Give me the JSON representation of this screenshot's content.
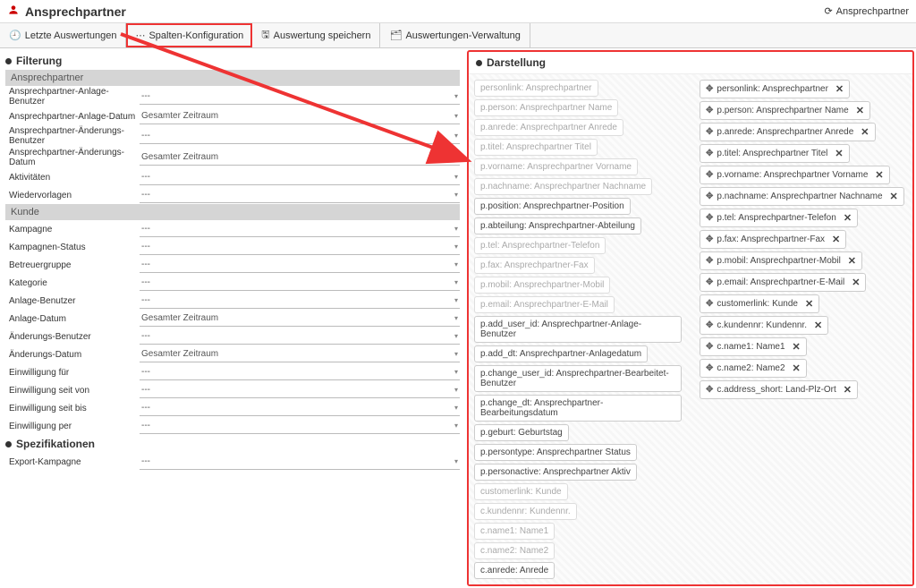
{
  "header": {
    "title": "Ansprechpartner",
    "refresh": "Ansprechpartner"
  },
  "toolbar": {
    "recent": "Letzte Auswertungen",
    "config": "Spalten-Konfiguration",
    "save": "Auswertung speichern",
    "manage": "Auswertungen-Verwaltung"
  },
  "filter": {
    "title": "Filterung",
    "groups": {
      "ansprechpartner": {
        "head": "Ansprechpartner",
        "rows": [
          {
            "label": "Ansprechpartner-Anlage-Benutzer",
            "value": "---"
          },
          {
            "label": "Ansprechpartner-Anlage-Datum",
            "value": "Gesamter Zeitraum"
          },
          {
            "label": "Ansprechpartner-Änderungs-Benutzer",
            "value": "---"
          },
          {
            "label": "Ansprechpartner-Änderungs-Datum",
            "value": "Gesamter Zeitraum"
          },
          {
            "label": "Aktivitäten",
            "value": "---"
          },
          {
            "label": "Wiedervorlagen",
            "value": "---"
          }
        ]
      },
      "kunde": {
        "head": "Kunde",
        "rows": [
          {
            "label": "Kampagne",
            "value": "---"
          },
          {
            "label": "Kampagnen-Status",
            "value": "---"
          },
          {
            "label": "Betreuergruppe",
            "value": "---"
          },
          {
            "label": "Kategorie",
            "value": "---"
          },
          {
            "label": "Anlage-Benutzer",
            "value": "---"
          },
          {
            "label": "Anlage-Datum",
            "value": "Gesamter Zeitraum"
          },
          {
            "label": "Änderungs-Benutzer",
            "value": "---"
          },
          {
            "label": "Änderungs-Datum",
            "value": "Gesamter Zeitraum"
          },
          {
            "label": "Einwilligung für",
            "value": "---"
          },
          {
            "label": "Einwilligung seit von",
            "value": "---"
          },
          {
            "label": "Einwilligung seit bis",
            "value": "---"
          },
          {
            "label": "Einwilligung per",
            "value": "---"
          }
        ]
      }
    },
    "spec": {
      "title": "Spezifikationen",
      "rows": [
        {
          "label": "Export-Kampagne",
          "value": "---"
        }
      ]
    }
  },
  "darstellung": {
    "title": "Darstellung",
    "available": [
      {
        "text": "personlink: Ansprechpartner",
        "disabled": true
      },
      {
        "text": "p.person: Ansprechpartner Name",
        "disabled": true
      },
      {
        "text": "p.anrede: Ansprechpartner Anrede",
        "disabled": true
      },
      {
        "text": "p.titel: Ansprechpartner Titel",
        "disabled": true
      },
      {
        "text": "p.vorname: Ansprechpartner Vorname",
        "disabled": true
      },
      {
        "text": "p.nachname: Ansprechpartner Nachname",
        "disabled": true
      },
      {
        "text": "p.position: Ansprechpartner-Position",
        "disabled": false
      },
      {
        "text": "p.abteilung: Ansprechpartner-Abteilung",
        "disabled": false
      },
      {
        "text": "p.tel: Ansprechpartner-Telefon",
        "disabled": true
      },
      {
        "text": "p.fax: Ansprechpartner-Fax",
        "disabled": true
      },
      {
        "text": "p.mobil: Ansprechpartner-Mobil",
        "disabled": true
      },
      {
        "text": "p.email: Ansprechpartner-E-Mail",
        "disabled": true
      },
      {
        "text": "p.add_user_id: Ansprechpartner-Anlage-Benutzer",
        "disabled": false
      },
      {
        "text": "p.add_dt: Ansprechpartner-Anlagedatum",
        "disabled": false
      },
      {
        "text": "p.change_user_id: Ansprechpartner-Bearbeitet-Benutzer",
        "disabled": false
      },
      {
        "text": "p.change_dt: Ansprechpartner-Bearbeitungsdatum",
        "disabled": false
      },
      {
        "text": "p.geburt: Geburtstag",
        "disabled": false
      },
      {
        "text": "p.persontype: Ansprechpartner Status",
        "disabled": false
      },
      {
        "text": "p.personactive: Ansprechpartner Aktiv",
        "disabled": false
      },
      {
        "text": "customerlink: Kunde",
        "disabled": true
      },
      {
        "text": "c.kundennr: Kundennr.",
        "disabled": true
      },
      {
        "text": "c.name1: Name1",
        "disabled": true
      },
      {
        "text": "c.name2: Name2",
        "disabled": true
      },
      {
        "text": "c.anrede: Anrede",
        "disabled": false
      }
    ],
    "selected": [
      "personlink: Ansprechpartner",
      "p.person: Ansprechpartner Name",
      "p.anrede: Ansprechpartner Anrede",
      "p.titel: Ansprechpartner Titel",
      "p.vorname: Ansprechpartner Vorname",
      "p.nachname: Ansprechpartner Nachname",
      "p.tel: Ansprechpartner-Telefon",
      "p.fax: Ansprechpartner-Fax",
      "p.mobil: Ansprechpartner-Mobil",
      "p.email: Ansprechpartner-E-Mail",
      "customerlink: Kunde",
      "c.kundennr: Kundennr.",
      "c.name1: Name1",
      "c.name2: Name2",
      "c.address_short: Land-Plz-Ort"
    ]
  }
}
